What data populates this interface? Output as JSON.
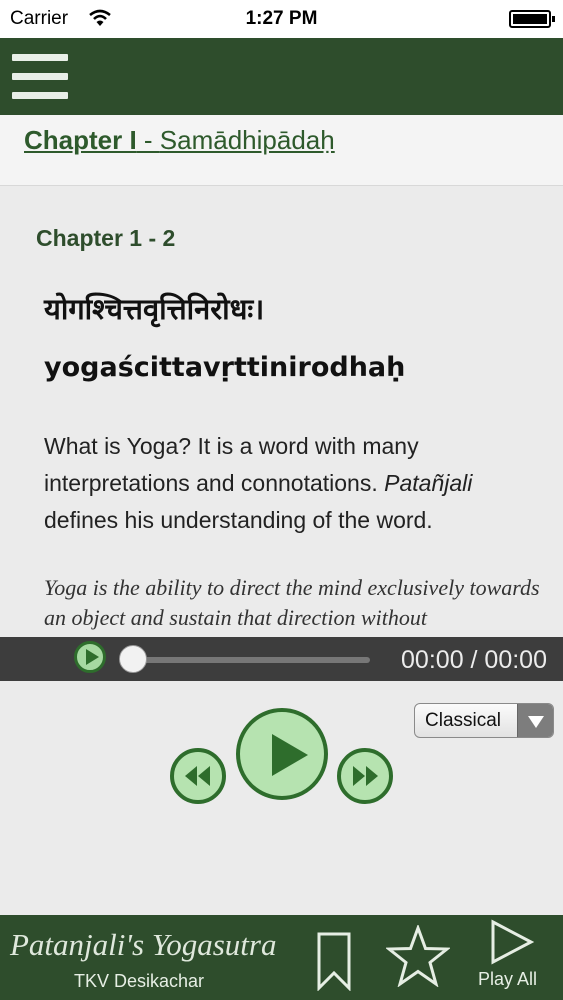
{
  "status_bar": {
    "carrier": "Carrier",
    "time": "1:27 PM"
  },
  "header": {
    "menu_icon": "hamburger-menu-icon"
  },
  "chapter": {
    "label": "Chapter I",
    "separator": " - ",
    "name": "Samādhipādaḥ"
  },
  "verse": {
    "title": "Chapter 1 - 2",
    "sanskrit": "योगश्चित्तवृत्तिनिरोधः।",
    "transliteration": "yogaścittavṛttinirodhaḥ",
    "commentary_part1": "What is Yoga? It is a word with many interpretations and connotations. ",
    "commentary_italic": "Patañjali",
    "commentary_part2": " defines his understanding of the word.",
    "definition": "Yoga is the ability to direct the mind exclusively towards an object and sustain that direction without"
  },
  "audio": {
    "time_display": "00:00 / 00:00",
    "progress": 0
  },
  "player": {
    "style_selected": "Classical",
    "icons": {
      "rewind": "rewind-icon",
      "play": "play-icon",
      "forward": "fast-forward-icon"
    }
  },
  "bottom_bar": {
    "app_title": "Patanjali's Yogasutra",
    "author": "TKV Desikachar",
    "bookmark_icon": "bookmark-icon",
    "favorite_icon": "star-icon",
    "play_all_label": "Play All"
  },
  "colors": {
    "brand_green": "#2e4d2c",
    "accent_green": "#2e6d2c",
    "button_fill": "#b6e3b0",
    "audio_bar": "#3d3d3d"
  }
}
